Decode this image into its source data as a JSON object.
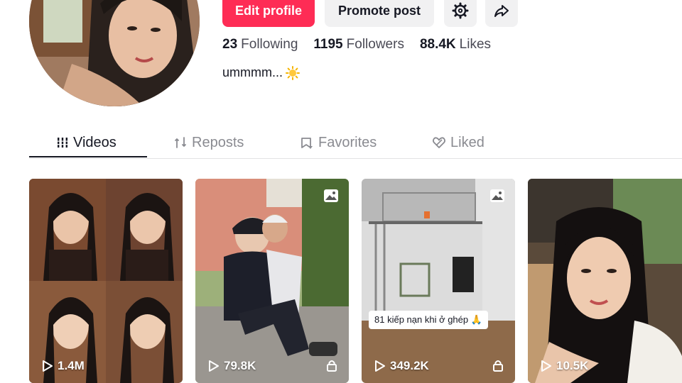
{
  "profile": {
    "edit_label": "Edit profile",
    "promote_label": "Promote post",
    "following_count": "23",
    "following_label": "Following",
    "followers_count": "1195",
    "followers_label": "Followers",
    "likes_count": "88.4K",
    "likes_label": "Likes",
    "bio": "ummmm...",
    "bio_emoji_icon": "sun-emoji-icon"
  },
  "tabs": [
    {
      "label": "Videos",
      "icon": "grid-icon",
      "active": true
    },
    {
      "label": "Reposts",
      "icon": "repost-icon",
      "active": false
    },
    {
      "label": "Favorites",
      "icon": "bookmark-icon",
      "active": false
    },
    {
      "label": "Liked",
      "icon": "heart-icon",
      "active": false
    }
  ],
  "videos": [
    {
      "views": "1.4M",
      "locked": false,
      "photo": false,
      "caption": ""
    },
    {
      "views": "79.8K",
      "locked": true,
      "photo": true,
      "caption": ""
    },
    {
      "views": "349.2K",
      "locked": true,
      "photo": true,
      "caption": "81 kiếp nạn khi ở ghép 🙏"
    },
    {
      "views": "10.5K",
      "locked": false,
      "photo": false,
      "caption": ""
    }
  ],
  "colors": {
    "accent": "#fe2c55",
    "text": "#161823",
    "muted": "#8a8b91",
    "button_bg": "#f1f1f2"
  }
}
